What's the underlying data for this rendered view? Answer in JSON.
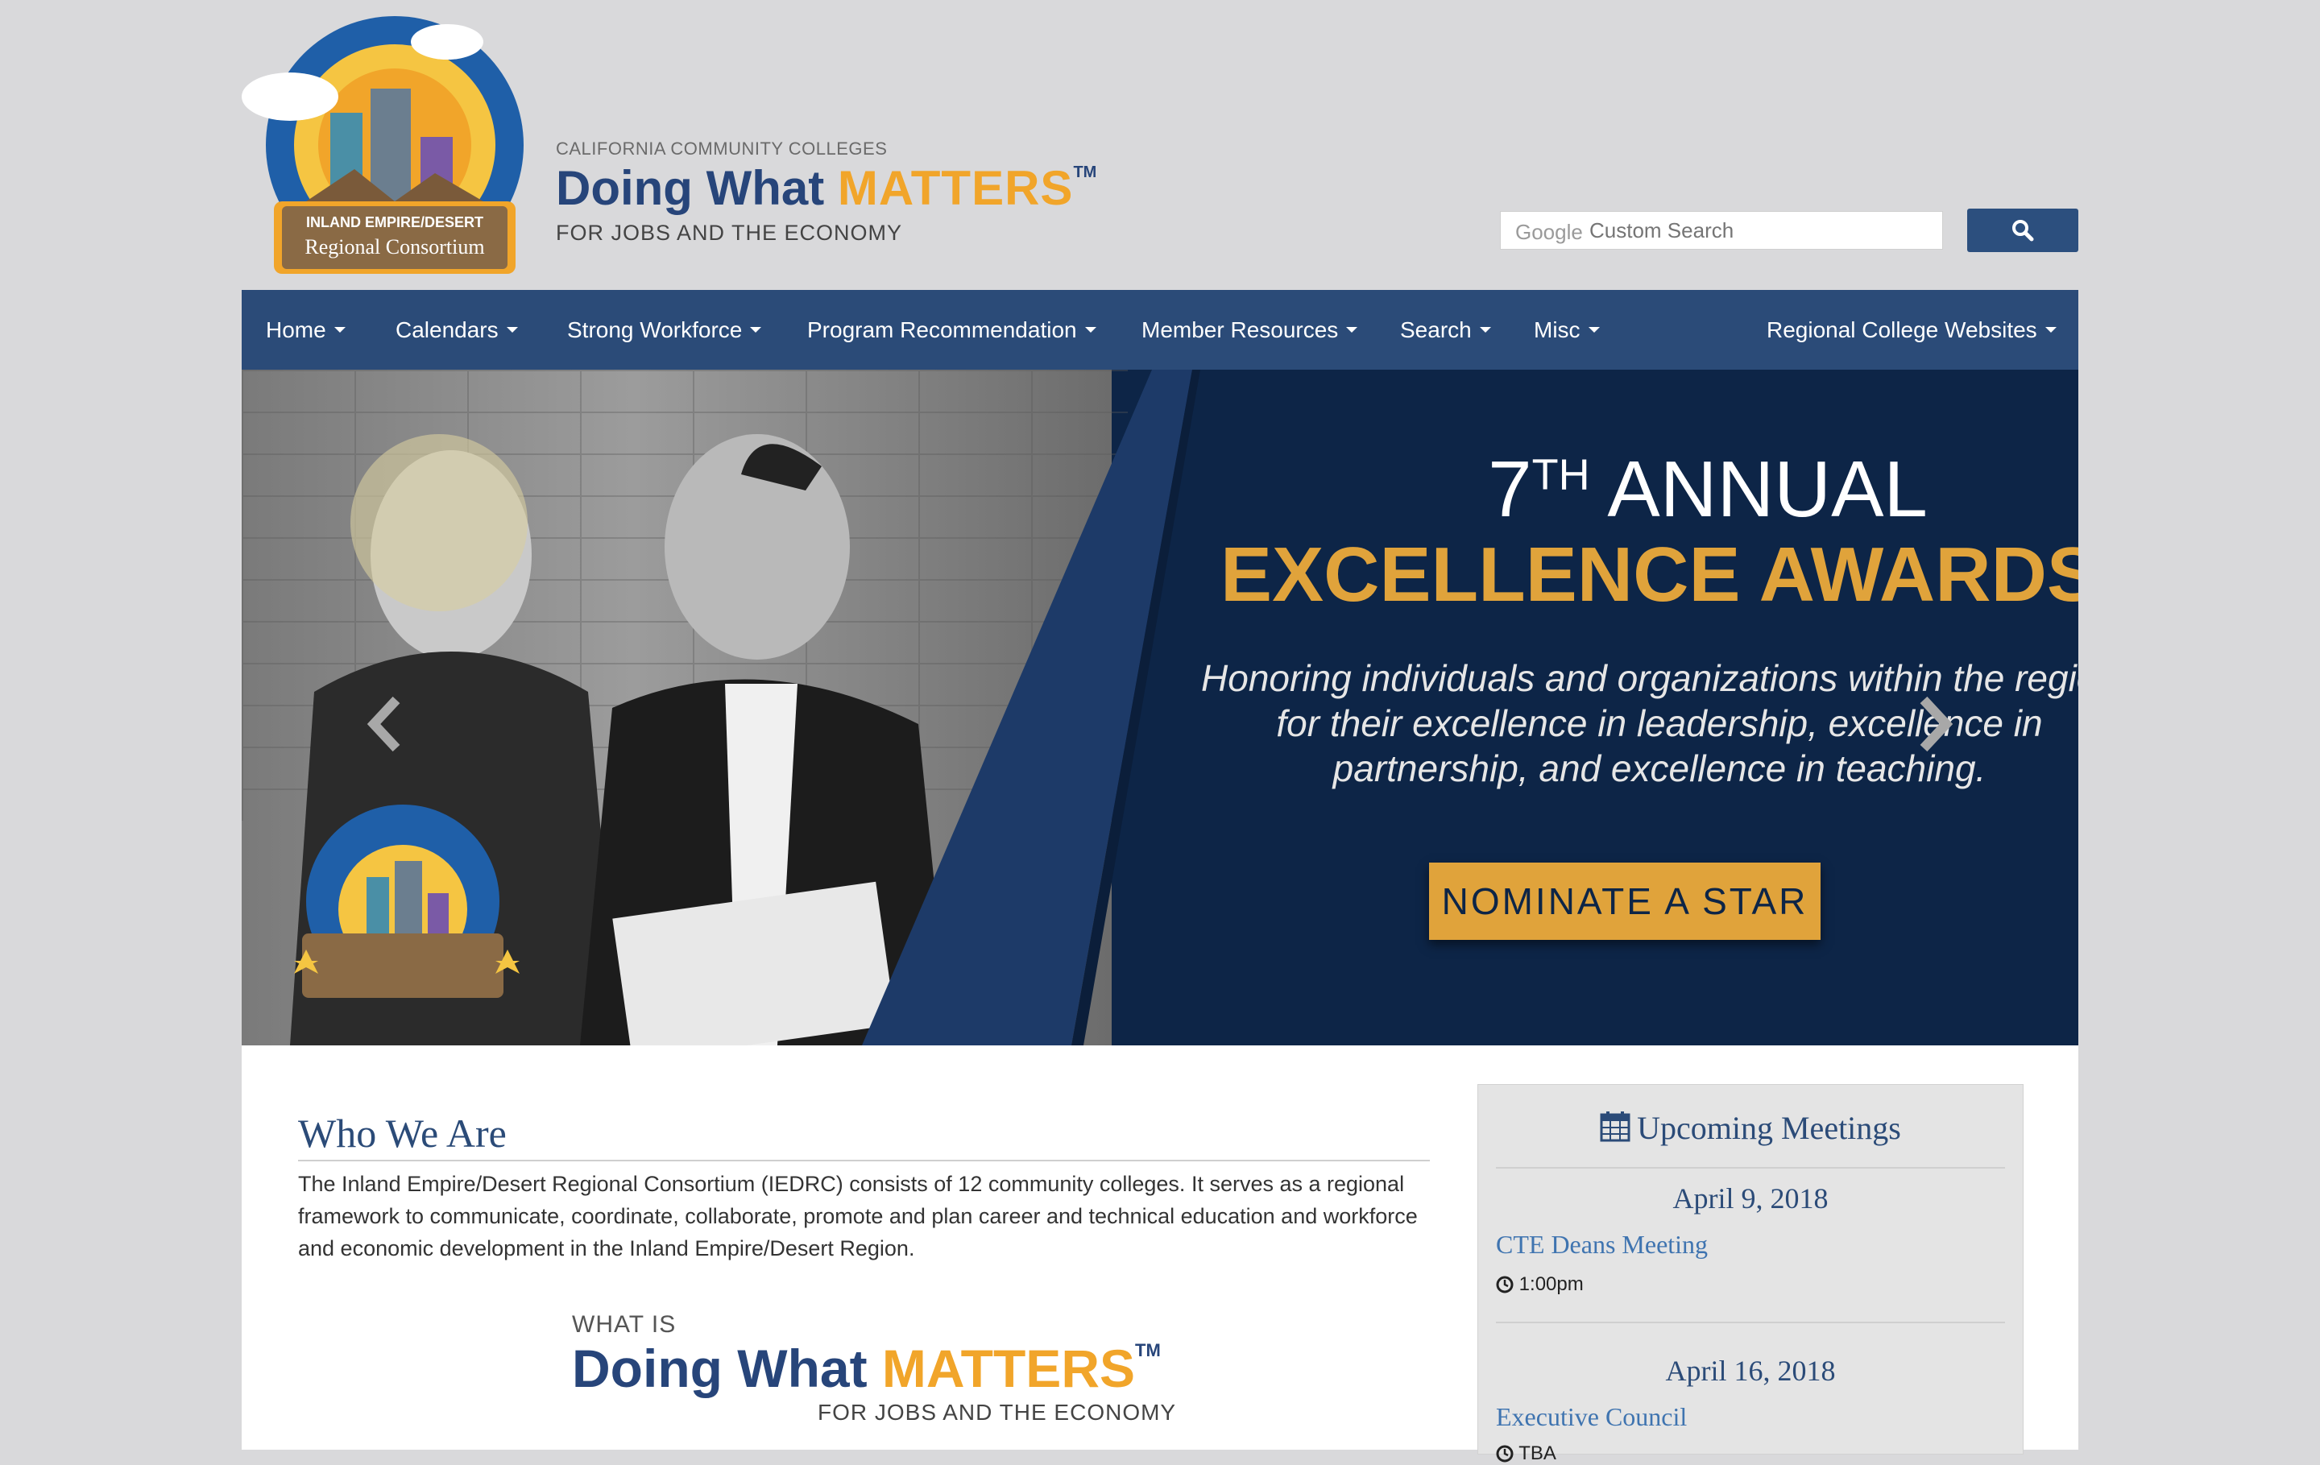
{
  "header": {
    "badge_line1": "INLAND EMPIRE/DESERT",
    "badge_line2": "Regional Consortium",
    "brand_top": "CALIFORNIA COMMUNITY COLLEGES",
    "brand_main_a": "Doing What ",
    "brand_main_b": "MATTERS",
    "brand_tm": "TM",
    "brand_sub": "FOR JOBS AND THE ECONOMY",
    "search_google": "Google",
    "search_placeholder": "Custom Search"
  },
  "nav": {
    "items": [
      "Home",
      "Calendars",
      "Strong Workforce",
      "Program Recommendation",
      "Member Resources",
      "Search",
      "Misc"
    ],
    "right_item": "Regional College Websites"
  },
  "hero": {
    "title_num": "7",
    "title_sup": "TH",
    "title_rest": " ANNUAL",
    "title2": "EXCELLENCE AWARDS",
    "desc": "Honoring individuals and organizations within the region for their excellence in leadership, excellence in partnership, and excellence in teaching.",
    "button": "NOMINATE A STAR"
  },
  "main": {
    "who_title": "Who We Are",
    "who_body": "The Inland Empire/Desert Regional Consortium (IEDRC) consists of 12 community colleges. It serves as a regional framework to communicate, coordinate, collaborate, promote and plan career and technical education and workforce and economic development in the Inland Empire/Desert Region.",
    "dwm_top": "WHAT IS",
    "dwm_main_a": "Doing What ",
    "dwm_main_b": "MATTERS",
    "dwm_tm": "TM",
    "dwm_sub": "FOR JOBS AND THE ECONOMY"
  },
  "meetings": {
    "title": "Upcoming Meetings",
    "items": [
      {
        "date": "April 9, 2018",
        "name": "CTE Deans Meeting",
        "time": "1:00pm"
      },
      {
        "date": "April 16, 2018",
        "name": "Executive Council",
        "time": "TBA"
      }
    ]
  },
  "colors": {
    "navy": "#2b4b78",
    "gold": "#e0a33b",
    "hero_bg": "#0d2547"
  }
}
